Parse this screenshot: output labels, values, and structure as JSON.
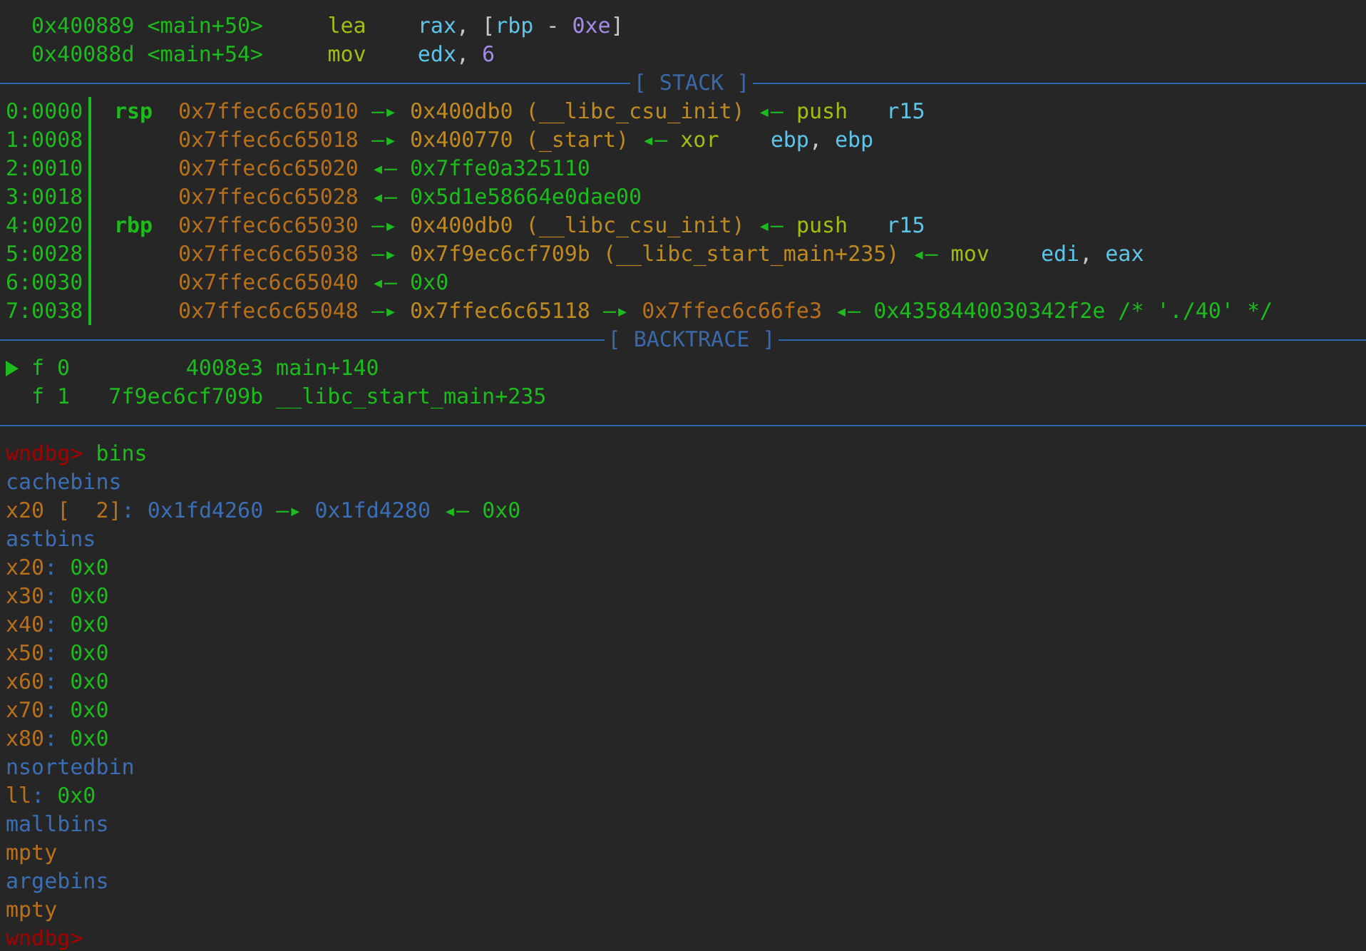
{
  "disassembly": [
    {
      "address": "0x400889",
      "symbol": "<main+50>",
      "mnemonic": "lea",
      "operands": [
        {
          "t": "rax",
          "kind": "reg"
        },
        {
          "t": ",",
          "kind": "comma"
        },
        {
          "t": "[",
          "kind": "bracket"
        },
        {
          "t": "rbp",
          "kind": "reg"
        },
        {
          "t": "-",
          "kind": "sign"
        },
        {
          "t": "0xe",
          "kind": "num"
        },
        {
          "t": "]",
          "kind": "bracket"
        }
      ]
    },
    {
      "address": "0x40088d",
      "symbol": "<main+54>",
      "mnemonic": "mov",
      "operands": [
        {
          "t": "edx",
          "kind": "reg"
        },
        {
          "t": ",",
          "kind": "comma"
        },
        {
          "t": "6",
          "kind": "num"
        }
      ]
    }
  ],
  "stack": {
    "title": "[ STACK ]",
    "rows": [
      {
        "offset": "0:0000",
        "register": "rsp",
        "chain": [
          {
            "t": "0x7ffec6c65010",
            "kind": "stack"
          },
          {
            "t": "—▸",
            "kind": "arrow"
          },
          {
            "t": "0x400db0 (__libc_csu_init)",
            "kind": "code"
          },
          {
            "t": "◂—",
            "kind": "arrow"
          },
          {
            "t": "push",
            "kind": "op"
          },
          {
            "t": "r15",
            "kind": "reg"
          }
        ]
      },
      {
        "offset": "1:0008",
        "chain": [
          {
            "t": "0x7ffec6c65018",
            "kind": "stack"
          },
          {
            "t": "—▸",
            "kind": "arrow"
          },
          {
            "t": "0x400770 (_start)",
            "kind": "code"
          },
          {
            "t": "◂—",
            "kind": "arrow"
          },
          {
            "t": "xor",
            "kind": "op"
          },
          {
            "t": "ebp",
            "kind": "reg"
          },
          {
            "t": ",",
            "kind": "comma"
          },
          {
            "t": "ebp",
            "kind": "reg"
          }
        ]
      },
      {
        "offset": "2:0010",
        "chain": [
          {
            "t": "0x7ffec6c65020",
            "kind": "stack"
          },
          {
            "t": "◂—",
            "kind": "arrow"
          },
          {
            "t": "0x7ffe0a325110",
            "kind": "data"
          }
        ]
      },
      {
        "offset": "3:0018",
        "chain": [
          {
            "t": "0x7ffec6c65028",
            "kind": "stack"
          },
          {
            "t": "◂—",
            "kind": "arrow"
          },
          {
            "t": "0x5d1e58664e0dae00",
            "kind": "data"
          }
        ]
      },
      {
        "offset": "4:0020",
        "register": "rbp",
        "chain": [
          {
            "t": "0x7ffec6c65030",
            "kind": "stack"
          },
          {
            "t": "—▸",
            "kind": "arrow"
          },
          {
            "t": "0x400db0 (__libc_csu_init)",
            "kind": "code"
          },
          {
            "t": "◂—",
            "kind": "arrow"
          },
          {
            "t": "push",
            "kind": "op"
          },
          {
            "t": "r15",
            "kind": "reg"
          }
        ]
      },
      {
        "offset": "5:0028",
        "chain": [
          {
            "t": "0x7ffec6c65038",
            "kind": "stack"
          },
          {
            "t": "—▸",
            "kind": "arrow"
          },
          {
            "t": "0x7f9ec6cf709b (__libc_start_main+235)",
            "kind": "code"
          },
          {
            "t": "◂—",
            "kind": "arrow"
          },
          {
            "t": "mov",
            "kind": "op"
          },
          {
            "t": "edi",
            "kind": "reg"
          },
          {
            "t": ",",
            "kind": "comma"
          },
          {
            "t": "eax",
            "kind": "reg"
          }
        ]
      },
      {
        "offset": "6:0030",
        "chain": [
          {
            "t": "0x7ffec6c65040",
            "kind": "stack"
          },
          {
            "t": "◂—",
            "kind": "arrow"
          },
          {
            "t": "0x0",
            "kind": "data"
          }
        ]
      },
      {
        "offset": "7:0038",
        "chain": [
          {
            "t": "0x7ffec6c65048",
            "kind": "stack"
          },
          {
            "t": "—▸",
            "kind": "arrow"
          },
          {
            "t": "0x7ffec6c65118",
            "kind": "code"
          },
          {
            "t": "—▸",
            "kind": "arrow"
          },
          {
            "t": "0x7ffec6c66fe3",
            "kind": "stack"
          },
          {
            "t": "◂—",
            "kind": "arrow"
          },
          {
            "t": "0x4358440030342f2e /* './40' */",
            "kind": "data"
          }
        ]
      }
    ]
  },
  "backtrace": {
    "title": "[ BACKTRACE ]",
    "frames": [
      {
        "selected": true,
        "frame": "f 0",
        "address": "4008e3",
        "function": "main+140"
      },
      {
        "selected": false,
        "frame": "f 1",
        "address": "7f9ec6cf709b",
        "function": "__libc_start_main+235"
      }
    ]
  },
  "console": [
    [
      {
        "t": "wndbg>",
        "kind": "prompt"
      },
      {
        "t": "bins",
        "kind": "cmd"
      }
    ],
    [
      {
        "t": "cachebins",
        "kind": "head"
      }
    ],
    [
      {
        "t": "x20 [  2]",
        "kind": "size"
      },
      {
        "t": ":",
        "kind": "colon"
      },
      {
        "t": "0x1fd4260",
        "kind": "heap"
      },
      {
        "t": "—▸",
        "kind": "arrow"
      },
      {
        "t": "0x1fd4280",
        "kind": "heap"
      },
      {
        "t": "◂—",
        "kind": "arrow"
      },
      {
        "t": "0x0",
        "kind": "data"
      }
    ],
    [
      {
        "t": "astbins",
        "kind": "head"
      }
    ],
    [
      {
        "t": "x20",
        "kind": "size"
      },
      {
        "t": ":",
        "kind": "colon"
      },
      {
        "t": "0x0",
        "kind": "data"
      }
    ],
    [
      {
        "t": "x30",
        "kind": "size"
      },
      {
        "t": ":",
        "kind": "colon"
      },
      {
        "t": "0x0",
        "kind": "data"
      }
    ],
    [
      {
        "t": "x40",
        "kind": "size"
      },
      {
        "t": ":",
        "kind": "colon"
      },
      {
        "t": "0x0",
        "kind": "data"
      }
    ],
    [
      {
        "t": "x50",
        "kind": "size"
      },
      {
        "t": ":",
        "kind": "colon"
      },
      {
        "t": "0x0",
        "kind": "data"
      }
    ],
    [
      {
        "t": "x60",
        "kind": "size"
      },
      {
        "t": ":",
        "kind": "colon"
      },
      {
        "t": "0x0",
        "kind": "data"
      }
    ],
    [
      {
        "t": "x70",
        "kind": "size"
      },
      {
        "t": ":",
        "kind": "colon"
      },
      {
        "t": "0x0",
        "kind": "data"
      }
    ],
    [
      {
        "t": "x80",
        "kind": "size"
      },
      {
        "t": ":",
        "kind": "colon"
      },
      {
        "t": "0x0",
        "kind": "data"
      }
    ],
    [
      {
        "t": "nsortedbin",
        "kind": "head"
      }
    ],
    [
      {
        "t": "ll",
        "kind": "size"
      },
      {
        "t": ":",
        "kind": "colon"
      },
      {
        "t": "0x0",
        "kind": "data"
      }
    ],
    [
      {
        "t": "mallbins",
        "kind": "head"
      }
    ],
    [
      {
        "t": "mpty",
        "kind": "size"
      }
    ],
    [
      {
        "t": "argebins",
        "kind": "head"
      }
    ],
    [
      {
        "t": "mpty",
        "kind": "size"
      }
    ],
    [
      {
        "t": "wndbg>",
        "kind": "prompt"
      }
    ]
  ]
}
